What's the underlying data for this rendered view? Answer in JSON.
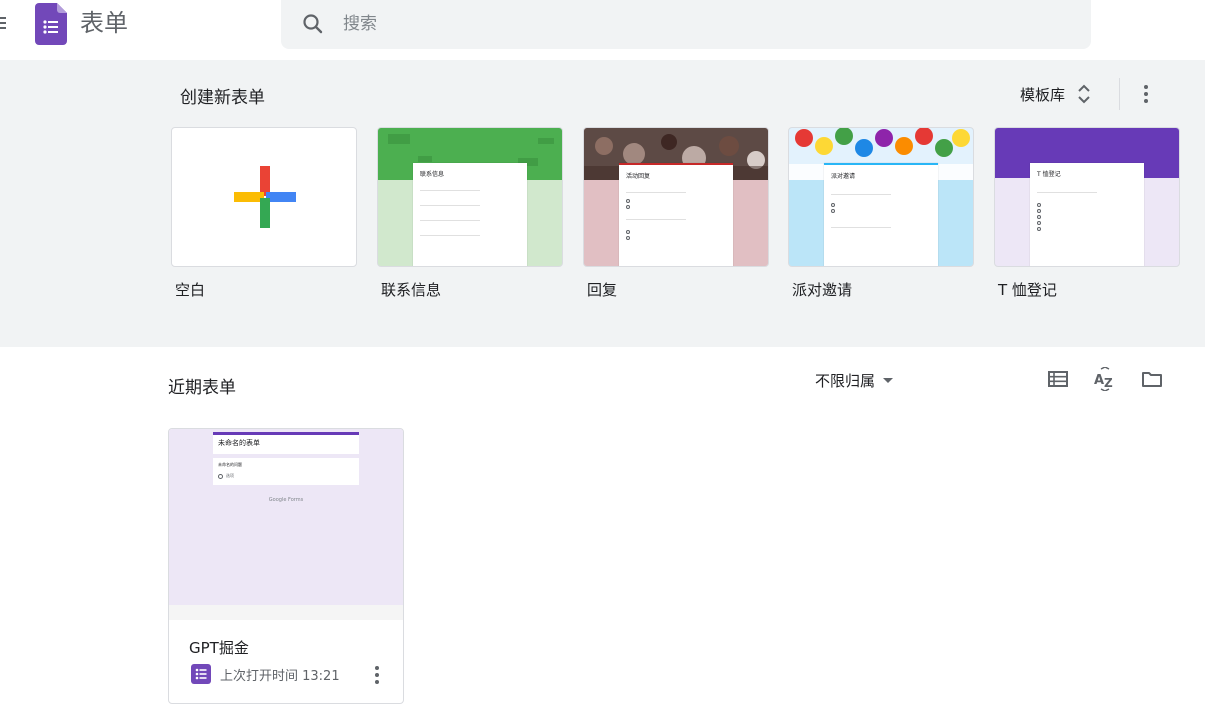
{
  "header": {
    "app_title": "表单",
    "search_placeholder": "搜索"
  },
  "gallery": {
    "title": "创建新表单",
    "template_gallery_label": "模板库",
    "templates": [
      {
        "label": "空白"
      },
      {
        "label": "联系信息",
        "form_title": "联系信息",
        "color": "#4caf50"
      },
      {
        "label": "回复",
        "form_title": "活动回复",
        "color": "#e1bfc3"
      },
      {
        "label": "派对邀请",
        "form_title": "派对邀请",
        "color": "#bbe5f8"
      },
      {
        "label": "T 恤登记",
        "form_title": "T 恤登记",
        "color": "#673ab7"
      }
    ]
  },
  "recent": {
    "title": "近期表单",
    "owner_filter": "不限归属",
    "docs": [
      {
        "title": "GPT掘金",
        "meta": "上次打开时间 13:21",
        "thumb_title": "未命名的表单",
        "thumb_question": "未命名的问题",
        "thumb_option": "选项",
        "thumb_brand": "Google Forms"
      }
    ]
  },
  "colors": {
    "forms_purple": "#673ab7",
    "gallery_bg": "#f1f3f4",
    "recent_thumb_bg": "#ede7f6"
  }
}
